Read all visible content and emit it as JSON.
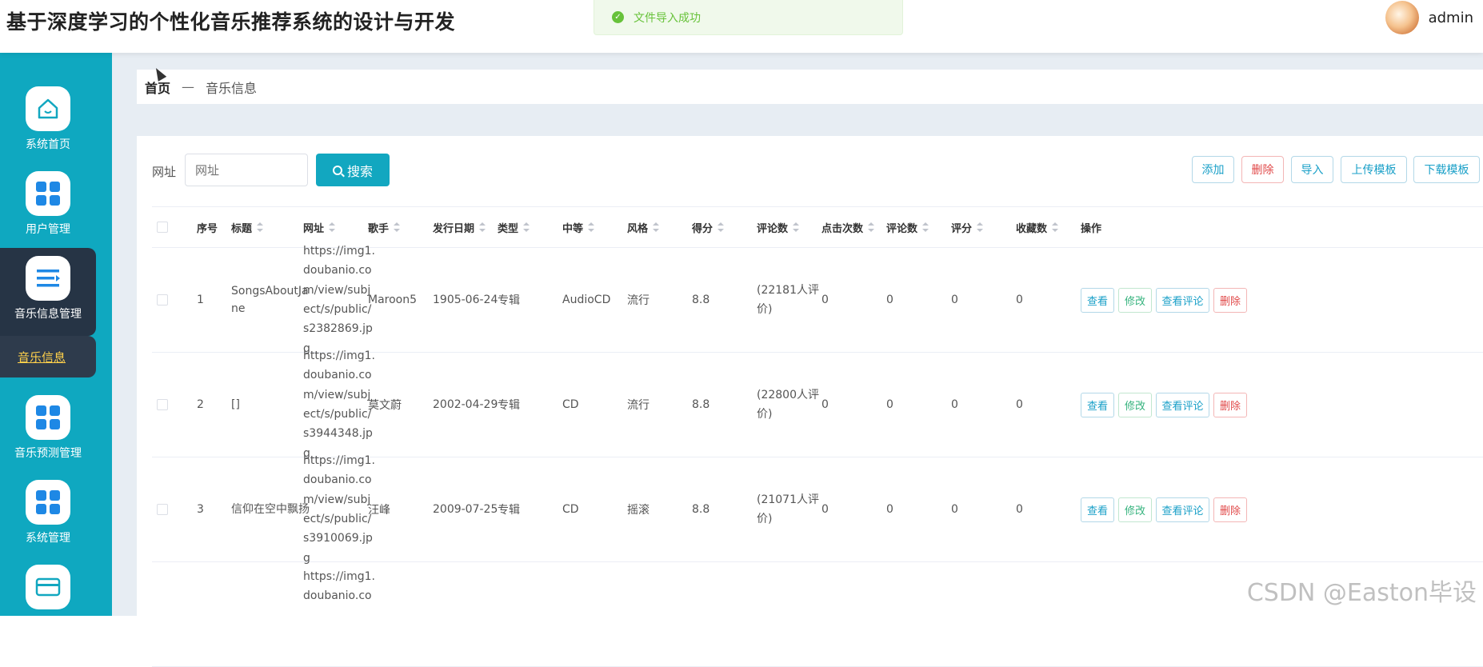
{
  "app": {
    "title": "基于深度学习的个性化音乐推荐系统的设计与开发",
    "username": "admin"
  },
  "toast": {
    "message": "文件导入成功"
  },
  "sidebar": {
    "items": [
      {
        "label": "系统首页",
        "icon": "home-icon"
      },
      {
        "label": "用户管理",
        "icon": "grid-icon"
      },
      {
        "label": "音乐信息管理",
        "icon": "list-icon"
      },
      {
        "label": "音乐预测管理",
        "icon": "grid-icon"
      },
      {
        "label": "系统管理",
        "icon": "grid-icon"
      },
      {
        "label": "",
        "icon": "card-icon"
      }
    ],
    "submenu": {
      "label": "音乐信息"
    }
  },
  "breadcrumb": {
    "home": "首页",
    "separator": "—",
    "current": "音乐信息"
  },
  "search": {
    "label": "网址",
    "placeholder": "网址",
    "button": "搜索"
  },
  "toolbar": {
    "add": "添加",
    "delete": "删除",
    "import": "导入",
    "upload_template": "上传模板",
    "download_template": "下载模板"
  },
  "table": {
    "columns": [
      "序号",
      "标题",
      "网址",
      "歌手",
      "发行日期",
      "类型",
      "中等",
      "风格",
      "得分",
      "评论数",
      "点击次数",
      "评论数",
      "评分",
      "收藏数",
      "操作"
    ],
    "rows": [
      {
        "index": "1",
        "title": "SongsAboutJane",
        "url": "https://img1.doubanio.com/view/subject/s/public/s2382869.jpg",
        "singer": "Maroon5",
        "date": "1905-06-24",
        "type": "专辑",
        "medium": "AudioCD",
        "style": "流行",
        "score": "8.8",
        "reviews": "(22181人评价)",
        "clicks": "0",
        "comments": "0",
        "rating": "0",
        "favorites": "0"
      },
      {
        "index": "2",
        "title": "[]",
        "url": "https://img1.doubanio.com/view/subject/s/public/s3944348.jpg",
        "singer": "莫文蔚",
        "date": "2002-04-29",
        "type": "专辑",
        "medium": "CD",
        "style": "流行",
        "score": "8.8",
        "reviews": "(22800人评价)",
        "clicks": "0",
        "comments": "0",
        "rating": "0",
        "favorites": "0"
      },
      {
        "index": "3",
        "title": "信仰在空中飘扬",
        "url": "https://img1.doubanio.com/view/subject/s/public/s3910069.jpg",
        "singer": "汪峰",
        "date": "2009-07-25",
        "type": "专辑",
        "medium": "CD",
        "style": "摇滚",
        "score": "8.8",
        "reviews": "(21071人评价)",
        "clicks": "0",
        "comments": "0",
        "rating": "0",
        "favorites": "0"
      },
      {
        "index": "",
        "title": "",
        "url": "https://img1.doubanio.co",
        "singer": "",
        "date": "",
        "type": "",
        "medium": "",
        "style": "",
        "score": "",
        "reviews": "",
        "clicks": "",
        "comments": "",
        "rating": "",
        "favorites": ""
      }
    ],
    "actions": {
      "view": "查看",
      "edit": "修改",
      "view_comments": "查看评论",
      "delete": "删除"
    }
  },
  "watermark": "CSDN @Easton毕设",
  "colors": {
    "sidebar": "#0fa8c0",
    "accent": "#12a7c0",
    "danger": "#e04848",
    "success": "#67c23a"
  }
}
